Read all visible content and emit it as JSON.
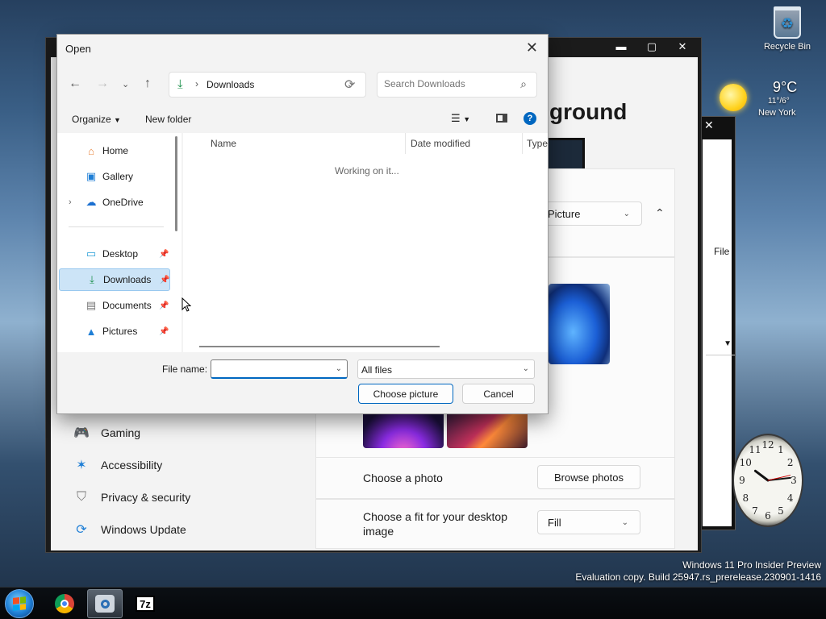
{
  "desktop": {
    "recycle_bin_label": "Recycle Bin",
    "weather": {
      "temp": "9°C",
      "range": "11°/6°",
      "city": "New York"
    },
    "watermark_line1": "Windows 11 Pro Insider Preview",
    "watermark_line2": "Evaluation copy. Build 25947.rs_prerelease.230901-1416",
    "clock_numbers": [
      "12",
      "1",
      "2",
      "3",
      "4",
      "5",
      "6",
      "7",
      "8",
      "9",
      "10",
      "11"
    ]
  },
  "settings_window": {
    "heading_partial": "ground",
    "picture_select": "Picture",
    "nav": [
      {
        "label": "Gaming",
        "icon": "gaming-icon"
      },
      {
        "label": "Accessibility",
        "icon": "accessibility-icon"
      },
      {
        "label": "Privacy & security",
        "icon": "shield-icon"
      },
      {
        "label": "Windows Update",
        "icon": "update-icon"
      }
    ],
    "choose_photo_label": "Choose a photo",
    "browse_photos_label": "Browse photos",
    "fit_label": "Choose a fit for your desktop image",
    "fit_value": "Fill"
  },
  "dialog": {
    "title": "Open",
    "address": "Downloads",
    "search_placeholder": "Search Downloads",
    "organize_label": "Organize",
    "new_folder_label": "New folder",
    "nav_items": [
      {
        "label": "Home",
        "icon": "home-icon"
      },
      {
        "label": "Gallery",
        "icon": "gallery-icon"
      },
      {
        "label": "OneDrive",
        "icon": "onedrive-icon"
      },
      {
        "label": "Desktop",
        "icon": "desktop-icon"
      },
      {
        "label": "Downloads",
        "icon": "downloads-icon"
      },
      {
        "label": "Documents",
        "icon": "documents-icon"
      },
      {
        "label": "Pictures",
        "icon": "pictures-icon"
      }
    ],
    "columns": [
      "Name",
      "Date modified",
      "Type"
    ],
    "status_text": "Working on it...",
    "file_name_label": "File name:",
    "file_name_value": "",
    "file_type_value": "All files",
    "choose_button": "Choose picture",
    "cancel_button": "Cancel"
  },
  "taskbar": {
    "apps": [
      "start-button",
      "chrome",
      "camera",
      "7-zip"
    ],
    "sevenzip_label": "7z"
  },
  "colors": {
    "accent": "#0067c0",
    "selection": "#cce4f7",
    "taskbar": "#050709"
  }
}
